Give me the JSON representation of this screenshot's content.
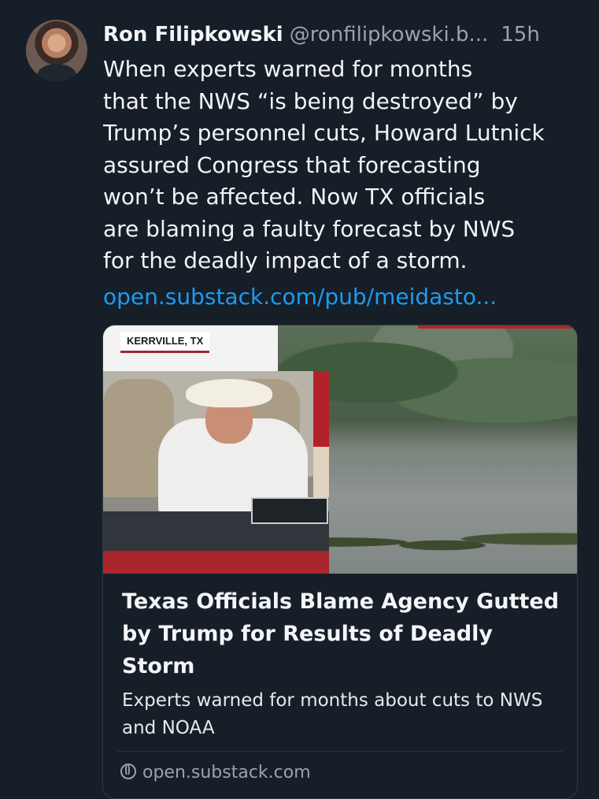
{
  "post": {
    "author_name": "Ron Filipkowski",
    "author_handle": "@ronfilipkowski.b...",
    "timestamp": "15h",
    "text_lines": [
      "When experts warned for months",
      "that the NWS “is being destroyed” by",
      "Trump’s personnel cuts, Howard Lutnick",
      "assured Congress that forecasting",
      "won’t be affected. Now TX officials",
      "are blaming a faulty forecast by NWS",
      "for the deadly impact of a storm."
    ],
    "link_text": "open.substack.com/pub/meidasto..."
  },
  "card": {
    "image_location_badge": "KERRVILLE, TX",
    "title": "Texas Officials Blame Agency Gutted by Trump for Results of Deadly Storm",
    "description": "Experts warned for months about cuts to NWS and NOAA",
    "domain": "open.substack.com",
    "domain_icon": "globe-icon"
  },
  "colors": {
    "background": "#161e27",
    "link": "#1d9bf0",
    "secondary_text": "#9aa3ad",
    "card_border": "#2f3a45"
  }
}
